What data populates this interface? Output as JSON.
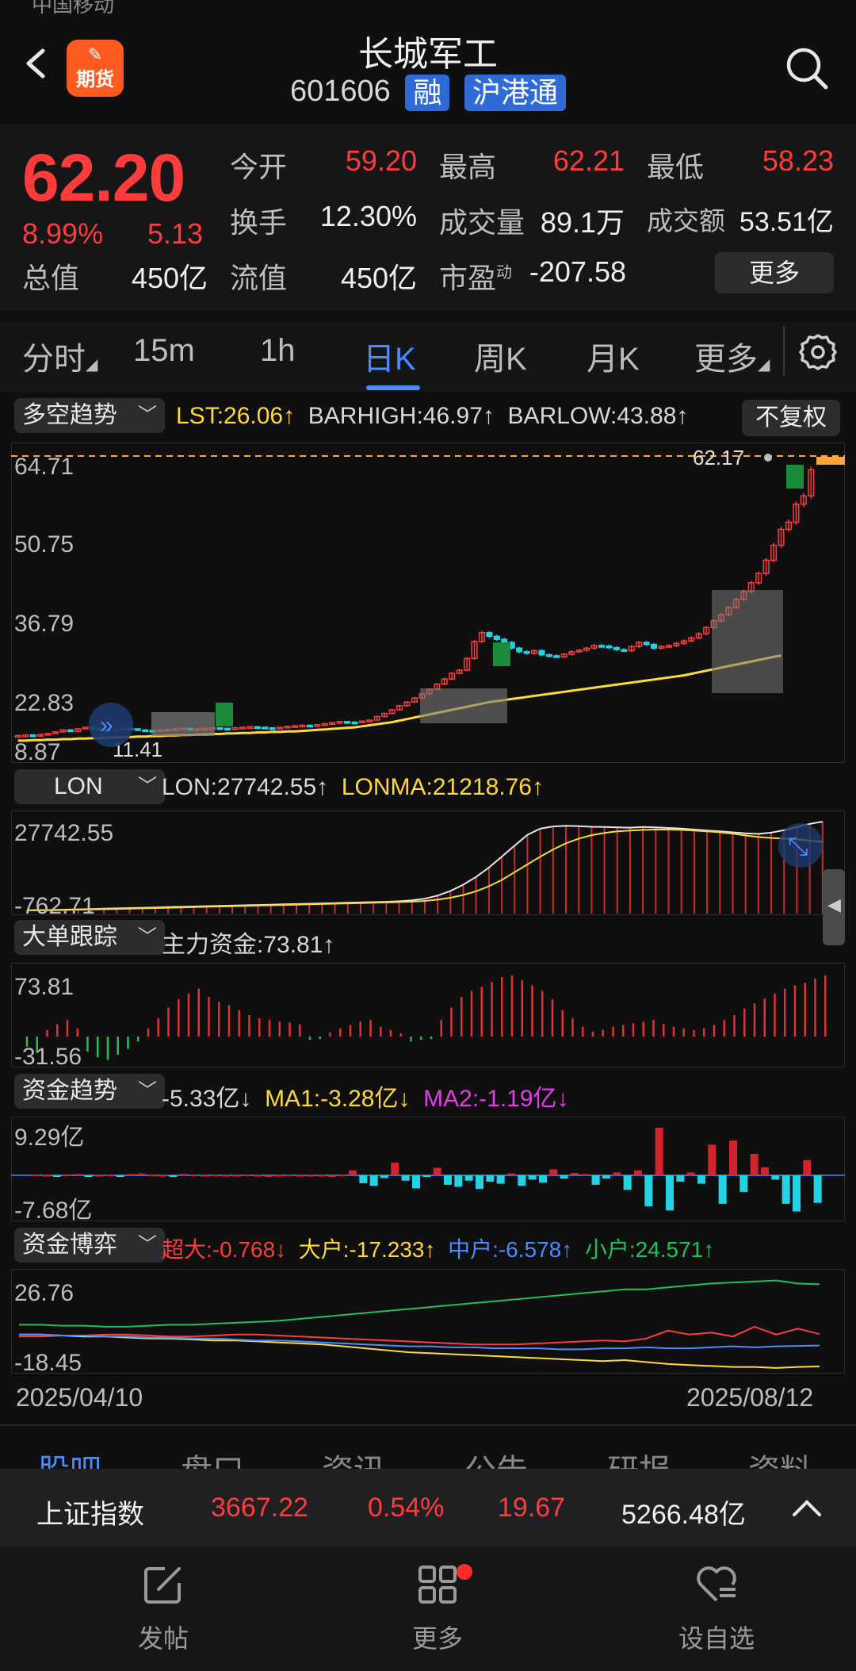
{
  "status": {
    "carrier": "中国移动"
  },
  "header": {
    "title": "长城军工",
    "code": "601606",
    "tags": [
      "融",
      "沪港通"
    ],
    "badge": "期货"
  },
  "quote": {
    "price": "62.20",
    "change_pct": "8.99%",
    "change": "5.13",
    "stats": [
      {
        "label": "今开",
        "value": "59.20"
      },
      {
        "label": "最高",
        "value": "62.21"
      },
      {
        "label": "最低",
        "value": "58.23"
      },
      {
        "label": "换手",
        "value": "12.30%"
      },
      {
        "label": "成交量",
        "value": "89.1万"
      },
      {
        "label": "成交额",
        "value": "53.51亿"
      },
      {
        "label": "总值",
        "value": "450亿"
      },
      {
        "label": "流值",
        "value": "450亿"
      },
      {
        "label": "市盈",
        "sup": "动",
        "value": "-207.58"
      }
    ],
    "more_label": "更多"
  },
  "period_tabs": [
    "分时",
    "15m",
    "1h",
    "日K",
    "周K",
    "月K",
    "更多"
  ],
  "active_period": "日K",
  "main_chart": {
    "indicator": "多空趋势",
    "legend": [
      {
        "text": "LST:26.06↑",
        "color": "#ffd83a"
      },
      {
        "text": "BARHIGH:46.97↑",
        "color": "#d8d8d8"
      },
      {
        "text": "BARLOW:43.88↑",
        "color": "#d8d8d8"
      }
    ],
    "fuquan": "不复权",
    "y_ticks": [
      "64.71",
      "50.75",
      "36.79",
      "22.83",
      "8.87"
    ],
    "last_price_label": "62.17",
    "low_label": "11.41"
  },
  "lon": {
    "indicator": "LON",
    "legend": [
      {
        "text": "LON:27742.55↑",
        "color": "#d8d8d8"
      },
      {
        "text": "LONMA:21218.76↑",
        "color": "#ffd83a"
      }
    ],
    "y_ticks": [
      "27742.55",
      "-762.71"
    ]
  },
  "big_order": {
    "indicator": "大单跟踪",
    "legend": [
      {
        "text": "主力资金:73.81↑",
        "color": "#d8d8d8"
      }
    ],
    "y_ticks": [
      "73.81",
      "-31.56"
    ]
  },
  "fund_trend": {
    "indicator": "资金趋势",
    "legend": [
      {
        "text": "-5.33亿↓",
        "color": "#d8d8d8"
      },
      {
        "text": "MA1:-3.28亿↓",
        "color": "#ffd83a"
      },
      {
        "text": "MA2:-1.19亿↓",
        "color": "#e23de6"
      }
    ],
    "y_ticks": [
      "9.29亿",
      "-7.68亿"
    ]
  },
  "fund_game": {
    "indicator": "资金博弈",
    "legend": [
      {
        "text": "超大:-0.768↓",
        "color": "#ff3b3b"
      },
      {
        "text": "大户:-17.233↑",
        "color": "#ffd83a"
      },
      {
        "text": "中户:-6.578↑",
        "color": "#4a8cff"
      },
      {
        "text": "小户:24.571↑",
        "color": "#1fc05a"
      }
    ],
    "y_ticks": [
      "26.76",
      "-18.45"
    ]
  },
  "dates": {
    "start": "2025/04/10",
    "end": "2025/08/12"
  },
  "bottom_tabs": [
    "股吧",
    "盘口",
    "资讯",
    "公告",
    "研报",
    "资料"
  ],
  "index_bar": {
    "name": "上证指数",
    "value": "3667.22",
    "pct": "0.54%",
    "change": "19.67",
    "turnover": "5266.48亿"
  },
  "nav": [
    {
      "label": "发帖",
      "icon": "edit-icon"
    },
    {
      "label": "更多",
      "icon": "grid-icon"
    },
    {
      "label": "设自选",
      "icon": "heart-list-icon"
    }
  ],
  "chart_data": [
    {
      "type": "candlestick",
      "title": "日K",
      "y_range": [
        8.87,
        64.71
      ],
      "x_range": [
        "2025/04/10",
        "2025/08/12"
      ],
      "close": [
        10.5,
        10.6,
        10.4,
        10.7,
        10.9,
        11.2,
        11.6,
        11.3,
        11.8,
        12.1,
        11.9,
        11.6,
        11.5,
        11.7,
        11.9,
        11.8,
        11.6,
        11.5,
        11.4,
        11.6,
        11.7,
        11.8,
        11.9,
        11.7,
        11.8,
        11.9,
        12.0,
        11.9,
        11.8,
        12.0,
        12.1,
        12.2,
        12.1,
        12.0,
        11.9,
        12.1,
        12.3,
        12.4,
        12.5,
        12.4,
        12.6,
        12.8,
        13.0,
        13.2,
        13.1,
        13.0,
        13.3,
        13.5,
        14.2,
        14.8,
        15.5,
        16.3,
        17.0,
        17.8,
        18.6,
        19.5,
        20.5,
        21.5,
        22.6,
        23.2,
        25.5,
        28.8,
        30.5,
        29.8,
        29.2,
        28.6,
        27.5,
        26.8,
        26.5,
        27.0,
        26.2,
        26.0,
        25.8,
        26.3,
        26.8,
        27.1,
        27.5,
        28.0,
        27.9,
        27.6,
        27.2,
        27.0,
        27.8,
        28.6,
        28.2,
        27.5,
        27.8,
        28.0,
        28.4,
        28.9,
        29.5,
        30.3,
        31.5,
        32.8,
        34.0,
        35.4,
        37.0,
        38.5,
        40.2,
        42.0,
        44.6,
        47.5,
        50.6,
        52.0,
        55.5,
        57.1,
        62.2
      ],
      "lst": [
        9.5,
        9.5,
        9.6,
        9.6,
        9.7,
        9.7,
        9.8,
        9.8,
        9.9,
        9.9,
        10.0,
        10.0,
        10.1,
        10.1,
        10.2,
        10.2,
        10.3,
        10.3,
        10.4,
        10.4,
        10.5,
        10.5,
        10.6,
        10.6,
        10.7,
        10.7,
        10.8,
        10.8,
        10.9,
        10.9,
        11.0,
        11.0,
        11.1,
        11.1,
        11.2,
        11.2,
        11.3,
        11.3,
        11.4,
        11.5,
        11.6,
        11.7,
        11.8,
        11.9,
        12.0,
        12.1,
        12.3,
        12.5,
        12.7,
        12.9,
        13.1,
        13.4,
        13.7,
        14.0,
        14.3,
        14.6,
        14.9,
        15.2,
        15.5,
        15.8,
        16.1,
        16.4,
        16.7,
        17.0,
        17.2,
        17.4,
        17.6,
        17.8,
        18.0,
        18.2,
        18.4,
        18.6,
        18.8,
        19.0,
        19.2,
        19.4,
        19.6,
        19.8,
        20.0,
        20.2,
        20.4,
        20.6,
        20.8,
        21.0,
        21.2,
        21.4,
        21.6,
        21.8,
        22.0,
        22.2,
        22.5,
        22.8,
        23.1,
        23.4,
        23.7,
        24.0,
        24.3,
        24.6,
        24.9,
        25.2,
        25.5,
        25.8,
        26.06
      ]
    },
    {
      "type": "line",
      "title": "LON",
      "y_range": [
        -762.71,
        27742.55
      ],
      "series": [
        {
          "name": "LON",
          "values": [
            -700,
            -650,
            -600,
            -500,
            -400,
            -300,
            -200,
            -100,
            0,
            100,
            200,
            300,
            400,
            500,
            600,
            700,
            800,
            900,
            1000,
            1100,
            1200,
            1300,
            1400,
            1500,
            1600,
            1700,
            1800,
            1900,
            2000,
            2200,
            2500,
            3000,
            4000,
            5500,
            7500,
            10000,
            13000,
            16500,
            20000,
            23500,
            25500,
            26200,
            26400,
            26300,
            26100,
            26000,
            25900,
            25800,
            26000,
            25900,
            25700,
            25500,
            25200,
            24900,
            24600,
            24300,
            24000,
            23800,
            24200,
            25000,
            26000,
            27000,
            27742.55
          ]
        },
        {
          "name": "LONMA",
          "values": [
            -700,
            -680,
            -650,
            -600,
            -520,
            -440,
            -360,
            -280,
            -200,
            -100,
            0,
            100,
            200,
            300,
            400,
            500,
            600,
            700,
            800,
            900,
            1000,
            1100,
            1200,
            1300,
            1400,
            1500,
            1600,
            1700,
            1800,
            1900,
            2050,
            2300,
            2700,
            3300,
            4200,
            5400,
            7000,
            9000,
            11500,
            14000,
            16500,
            18800,
            20800,
            22300,
            23400,
            24100,
            24600,
            24900,
            25100,
            25200,
            25200,
            25100,
            24900,
            24600,
            24300,
            23900,
            23300,
            22800,
            22500,
            22300,
            22100,
            21600,
            21218.76
          ]
        }
      ]
    },
    {
      "type": "bar",
      "title": "大单跟踪",
      "y_range": [
        -31.56,
        73.81
      ],
      "series": [
        {
          "name": "主力资金",
          "values": [
            -12,
            -20,
            8,
            15,
            20,
            10,
            -18,
            -25,
            -28,
            -22,
            -15,
            -6,
            10,
            22,
            35,
            45,
            52,
            58,
            48,
            42,
            38,
            32,
            26,
            22,
            20,
            18,
            17,
            15,
            -4,
            -3,
            5,
            10,
            14,
            18,
            20,
            12,
            8,
            4,
            -6,
            -4,
            -3,
            20,
            35,
            48,
            55,
            60,
            66,
            72,
            74,
            68,
            62,
            55,
            45,
            32,
            22,
            12,
            6,
            8,
            12,
            14,
            16,
            18,
            20,
            15,
            12,
            10,
            8,
            10,
            14,
            20,
            26,
            34,
            40,
            46,
            52,
            58,
            62,
            65,
            70,
            73.81
          ]
        }
      ]
    },
    {
      "type": "bar",
      "title": "资金趋势",
      "y_range": [
        -7.68,
        9.29
      ],
      "unit": "亿",
      "series": [
        {
          "name": "资金趋势",
          "values": [
            0.2,
            0.1,
            -0.1,
            0.2,
            0.3,
            -0.2,
            0.1,
            0.2,
            -0.1,
            0.3,
            0.4,
            0.2,
            0.1,
            -0.2,
            0.3,
            0.2,
            0.1,
            0.2,
            0.1,
            0.1,
            0.2,
            0.1,
            0.0,
            0.1,
            0.2,
            0.1,
            0.1,
            0.1,
            0.0,
            0.2,
            1.0,
            -1.5,
            -2.0,
            -0.5,
            2.5,
            -1.0,
            -2.5,
            -0.3,
            1.5,
            -1.8,
            -2.2,
            -1.0,
            -2.6,
            -1.2,
            -1.6,
            0.4,
            -2.0,
            -0.8,
            -1.4,
            1.2,
            -0.6,
            0.5,
            0.3,
            -1.8,
            -0.6,
            0.6,
            -2.8,
            1.0,
            -6.0,
            9.29,
            -6.8,
            -1.2,
            0.6,
            -1.6,
            6.0,
            -5.5,
            6.8,
            -3.2,
            4.2,
            1.6,
            -0.8,
            -5.5,
            -7.0,
            3.0,
            -5.33
          ]
        }
      ]
    },
    {
      "type": "line",
      "title": "资金博弈",
      "y_range": [
        -18.45,
        26.76
      ],
      "series": [
        {
          "name": "超大",
          "values": [
            -2,
            -2,
            -1.5,
            -1.5,
            -1,
            -1,
            -1.5,
            -2,
            -2,
            -1.5,
            -1,
            -1,
            -1.5,
            -2,
            -2.5,
            -3,
            -3.5,
            -4,
            -4.5,
            -5,
            -5.5,
            -6,
            -6,
            -6,
            -5.5,
            -5,
            -4.5,
            -4,
            -4.5,
            -3,
            1,
            -1,
            0,
            -2,
            3,
            -1,
            2,
            -0.768
          ]
        },
        {
          "name": "大户",
          "values": [
            -1,
            -1,
            -1.5,
            -2,
            -2,
            -2.5,
            -3,
            -3,
            -3.5,
            -4,
            -4,
            -4.5,
            -5,
            -5.5,
            -6,
            -7,
            -8,
            -9,
            -10,
            -10.5,
            -11,
            -11.5,
            -12,
            -12.5,
            -13,
            -13.5,
            -14,
            -14.5,
            -14,
            -15,
            -16,
            -16.5,
            -17,
            -17.5,
            -17.5,
            -18,
            -17.5,
            -17.233
          ]
        },
        {
          "name": "中户",
          "values": [
            -1,
            -1,
            -1.5,
            -1.5,
            -2,
            -2,
            -2.5,
            -2.5,
            -3,
            -3,
            -3.5,
            -4,
            -4,
            -4.5,
            -5,
            -5.5,
            -6,
            -6.5,
            -7,
            -7,
            -7.5,
            -7.5,
            -8,
            -8,
            -8,
            -8.5,
            -8.5,
            -8,
            -8,
            -7.5,
            -8,
            -8,
            -7.5,
            -7,
            -7.5,
            -7,
            -6.8,
            -6.578
          ]
        },
        {
          "name": "小户",
          "values": [
            4,
            4,
            3.5,
            3.5,
            3,
            3,
            3.5,
            4,
            4,
            4.5,
            5,
            5.5,
            6,
            7,
            8,
            9,
            10,
            11,
            12,
            13,
            14,
            15,
            16,
            17,
            18,
            19,
            20,
            21,
            22,
            22,
            23,
            24,
            25,
            25.5,
            26,
            26.5,
            25,
            24.571
          ]
        }
      ]
    }
  ]
}
